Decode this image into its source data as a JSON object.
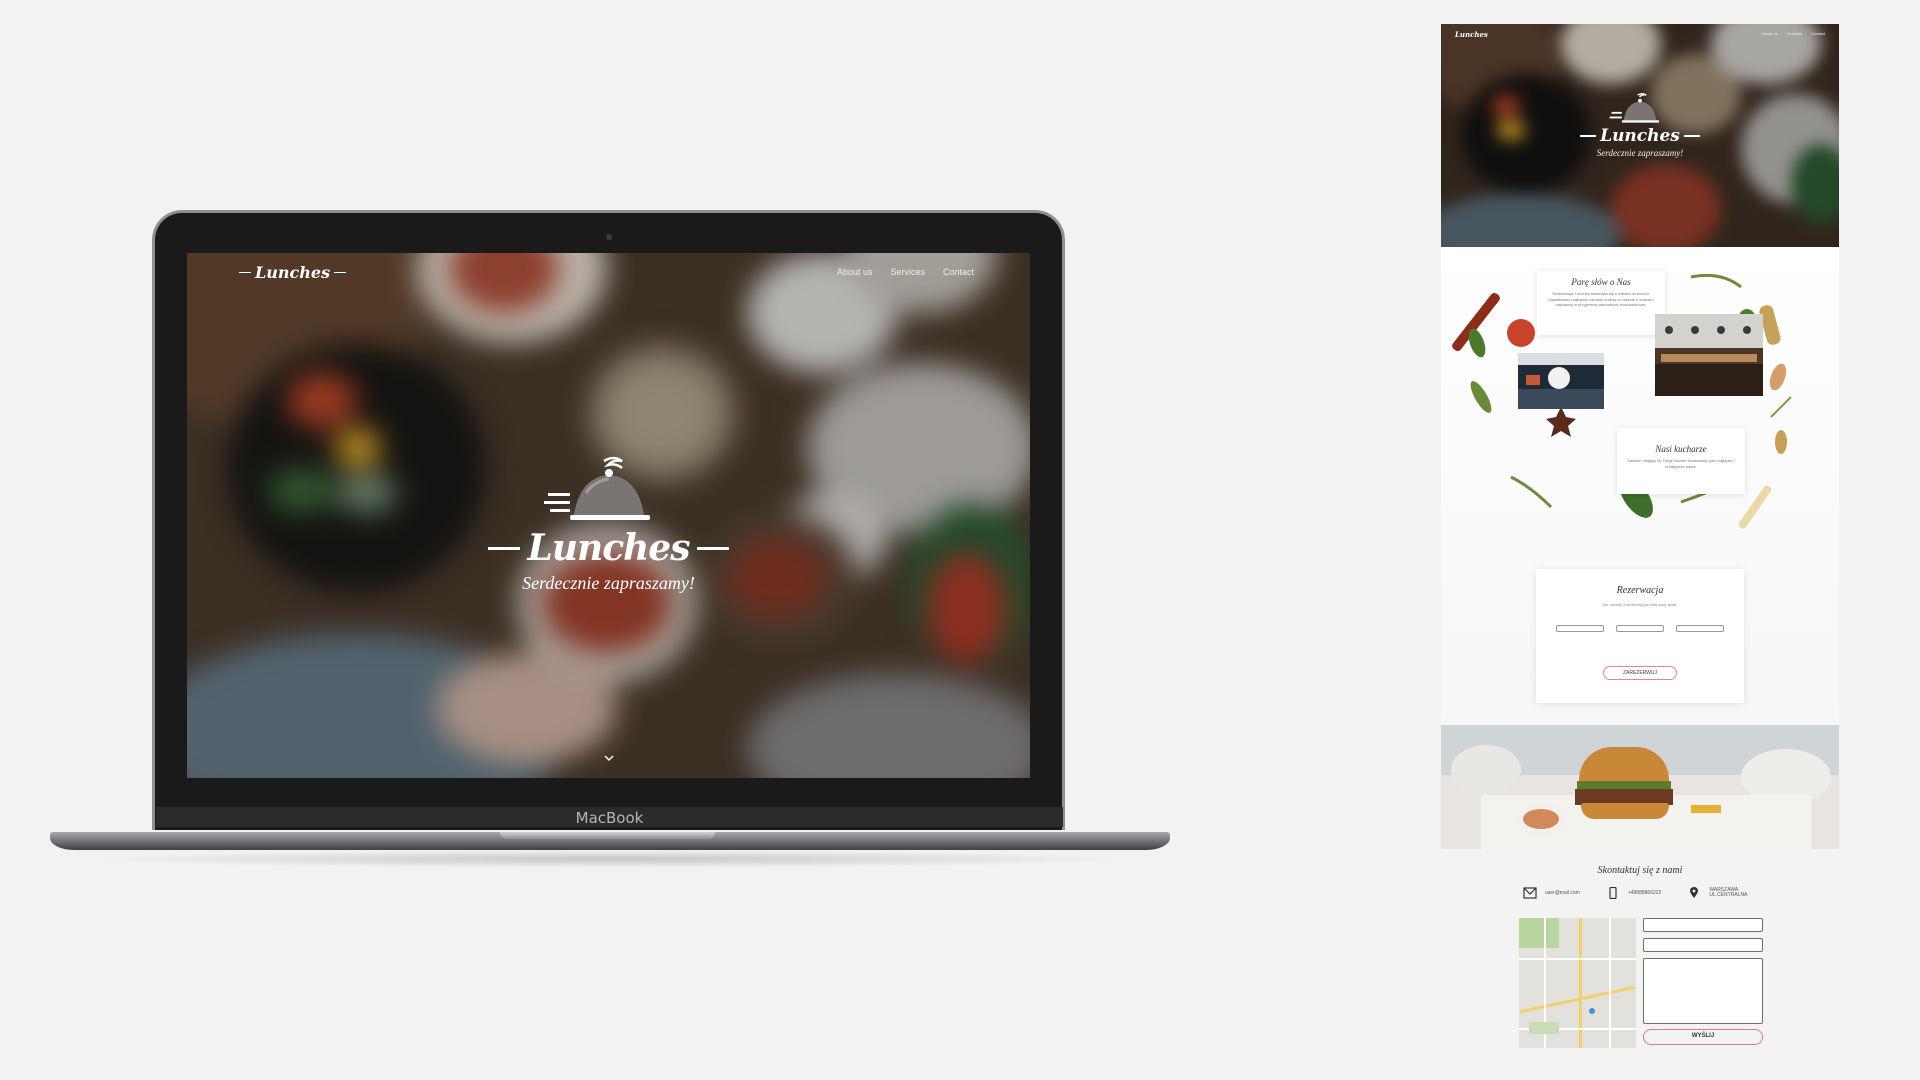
{
  "laptop": {
    "brand_label": "MacBook",
    "nav": {
      "logo": "Lunches",
      "links": [
        "About us",
        "Services",
        "Contact"
      ]
    },
    "hero": {
      "title": "Lunches",
      "subtitle": "Serdecznie zapraszamy!",
      "icons": [
        "cloche-icon",
        "chevron-down-icon"
      ]
    }
  },
  "preview": {
    "nav": {
      "logo": "Lunches",
      "links": [
        "About us",
        "Services",
        "Contact"
      ]
    },
    "hero": {
      "title": "Lunches",
      "subtitle": "Serdecznie zapraszamy!"
    },
    "about": {
      "title": "Parę słów o Nas",
      "text": "Restauracja Lunches stworzyła się z miłości do kuchni. Zapraszamy najlepszy ośrodek kultury w mieście o sukces i naprawdę w przyjemnej atmosferze środowiskowej.",
      "chefs_title": "Nasi kucharze",
      "chefs_text": "Zawsze dbający by Twoje lokowe smakowały tylko najlepiej i kreatywnie dania."
    },
    "reservation": {
      "title": "Rezerwacja",
      "text": "Nie czekaj! Zarezerwuj już dziś swój stolik.",
      "button": "ZAREZERWUJ"
    },
    "contact": {
      "title": "Skontaktuj się z nami",
      "email": "user@mail.com",
      "phone": "+48888866222",
      "address_line1": "WARSZAWA",
      "address_line2": "UL.CENTRALNA",
      "button": "WYŚLIJ"
    }
  },
  "colors": {
    "background": "#f2f2f2",
    "accent": "#e07b7b",
    "laptop_frame": "#1a1a1a"
  }
}
